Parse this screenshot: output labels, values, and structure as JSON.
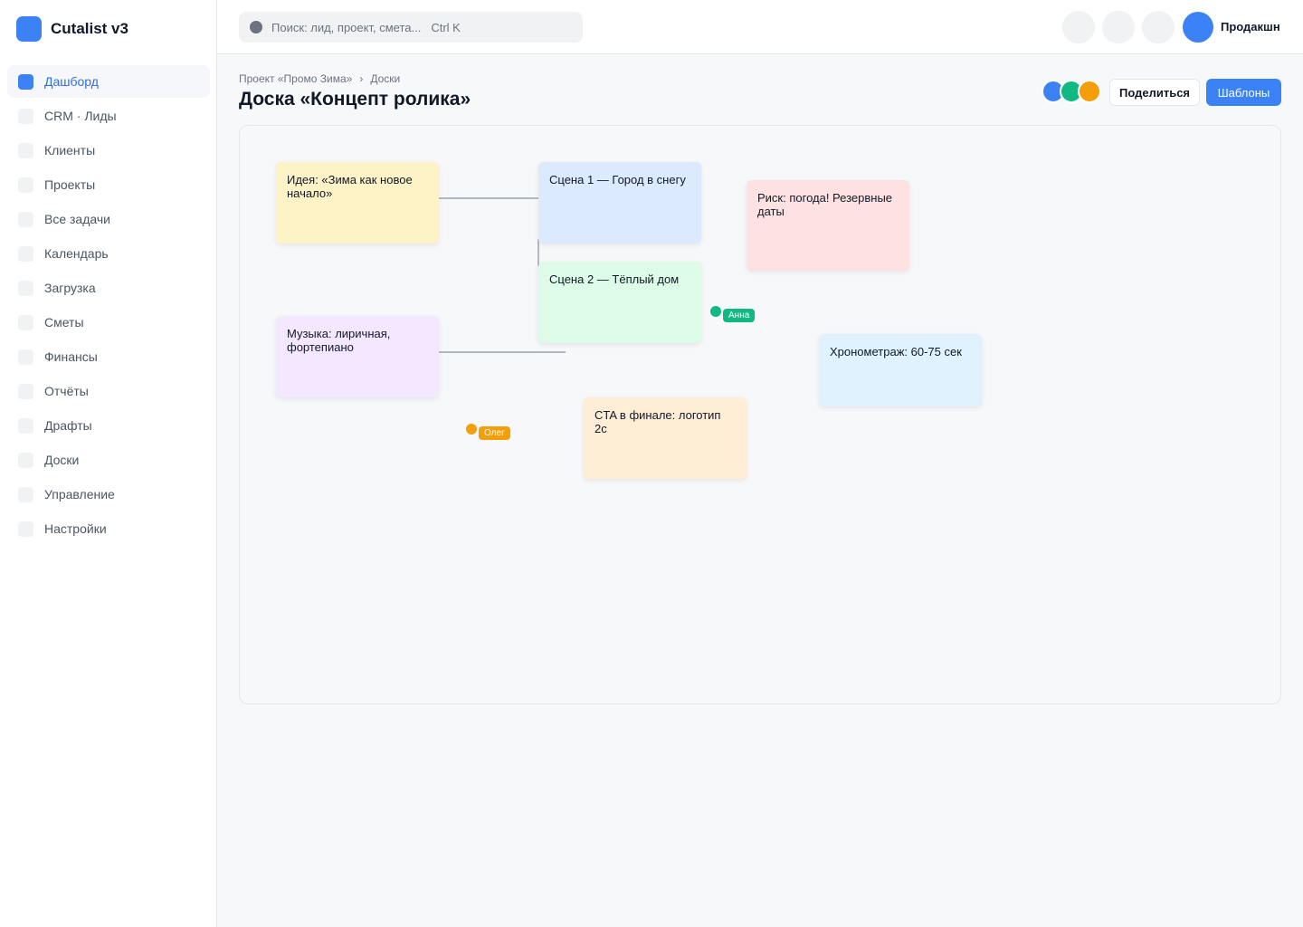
{
  "app": {
    "name": "Cutalist v3"
  },
  "sidebar": {
    "items": [
      {
        "label": "Дашборд",
        "active": true
      },
      {
        "label": "CRM · Лиды"
      },
      {
        "label": "Клиенты"
      },
      {
        "label": "Проекты"
      },
      {
        "label": "Все задачи"
      },
      {
        "label": "Календарь"
      },
      {
        "label": "Загрузка"
      },
      {
        "label": "Сметы"
      },
      {
        "label": "Финансы"
      },
      {
        "label": "Отчёты"
      },
      {
        "label": "Драфты"
      },
      {
        "label": "Доски"
      },
      {
        "label": "Управление"
      },
      {
        "label": "Настройки"
      }
    ]
  },
  "header": {
    "search_placeholder": "Поиск: лид, проект, смета...",
    "search_shortcut": "Ctrl K",
    "user_name": "Продакшн"
  },
  "page": {
    "breadcrumb": [
      "Проект «Промо Зима»",
      "Доски"
    ],
    "breadcrumb_separator": "›",
    "title": "Доска «Концепт ролика»",
    "share_label": "Поделиться",
    "templates_label": "Шаблоны",
    "collaborator_colors": [
      "#3b82f6",
      "#10b981",
      "#f59e0b"
    ]
  },
  "board": {
    "notes": [
      {
        "text": "Идея: «Зима как новое начало»",
        "color": "#fef3c7"
      },
      {
        "text": "Сцена 1 — Город в снегу",
        "color": "#dbeafe"
      },
      {
        "text": "Сцена 2 — Тёплый дом",
        "color": "#dcfce7"
      },
      {
        "text": "Риск: погода! Резервные даты",
        "color": "#fee2e2"
      },
      {
        "text": "Музыка: лиричная, фортепиано",
        "color": "#f3e8ff"
      },
      {
        "text": "Хронометраж: 60-75 сек",
        "color": "#e0f2fe"
      },
      {
        "text": "CTA в финале: логотип 2с",
        "color": "#ffedd5"
      }
    ],
    "cursors": [
      {
        "name": "Анна",
        "color": "#10b981"
      },
      {
        "name": "Олег",
        "color": "#f59e0b"
      }
    ]
  }
}
